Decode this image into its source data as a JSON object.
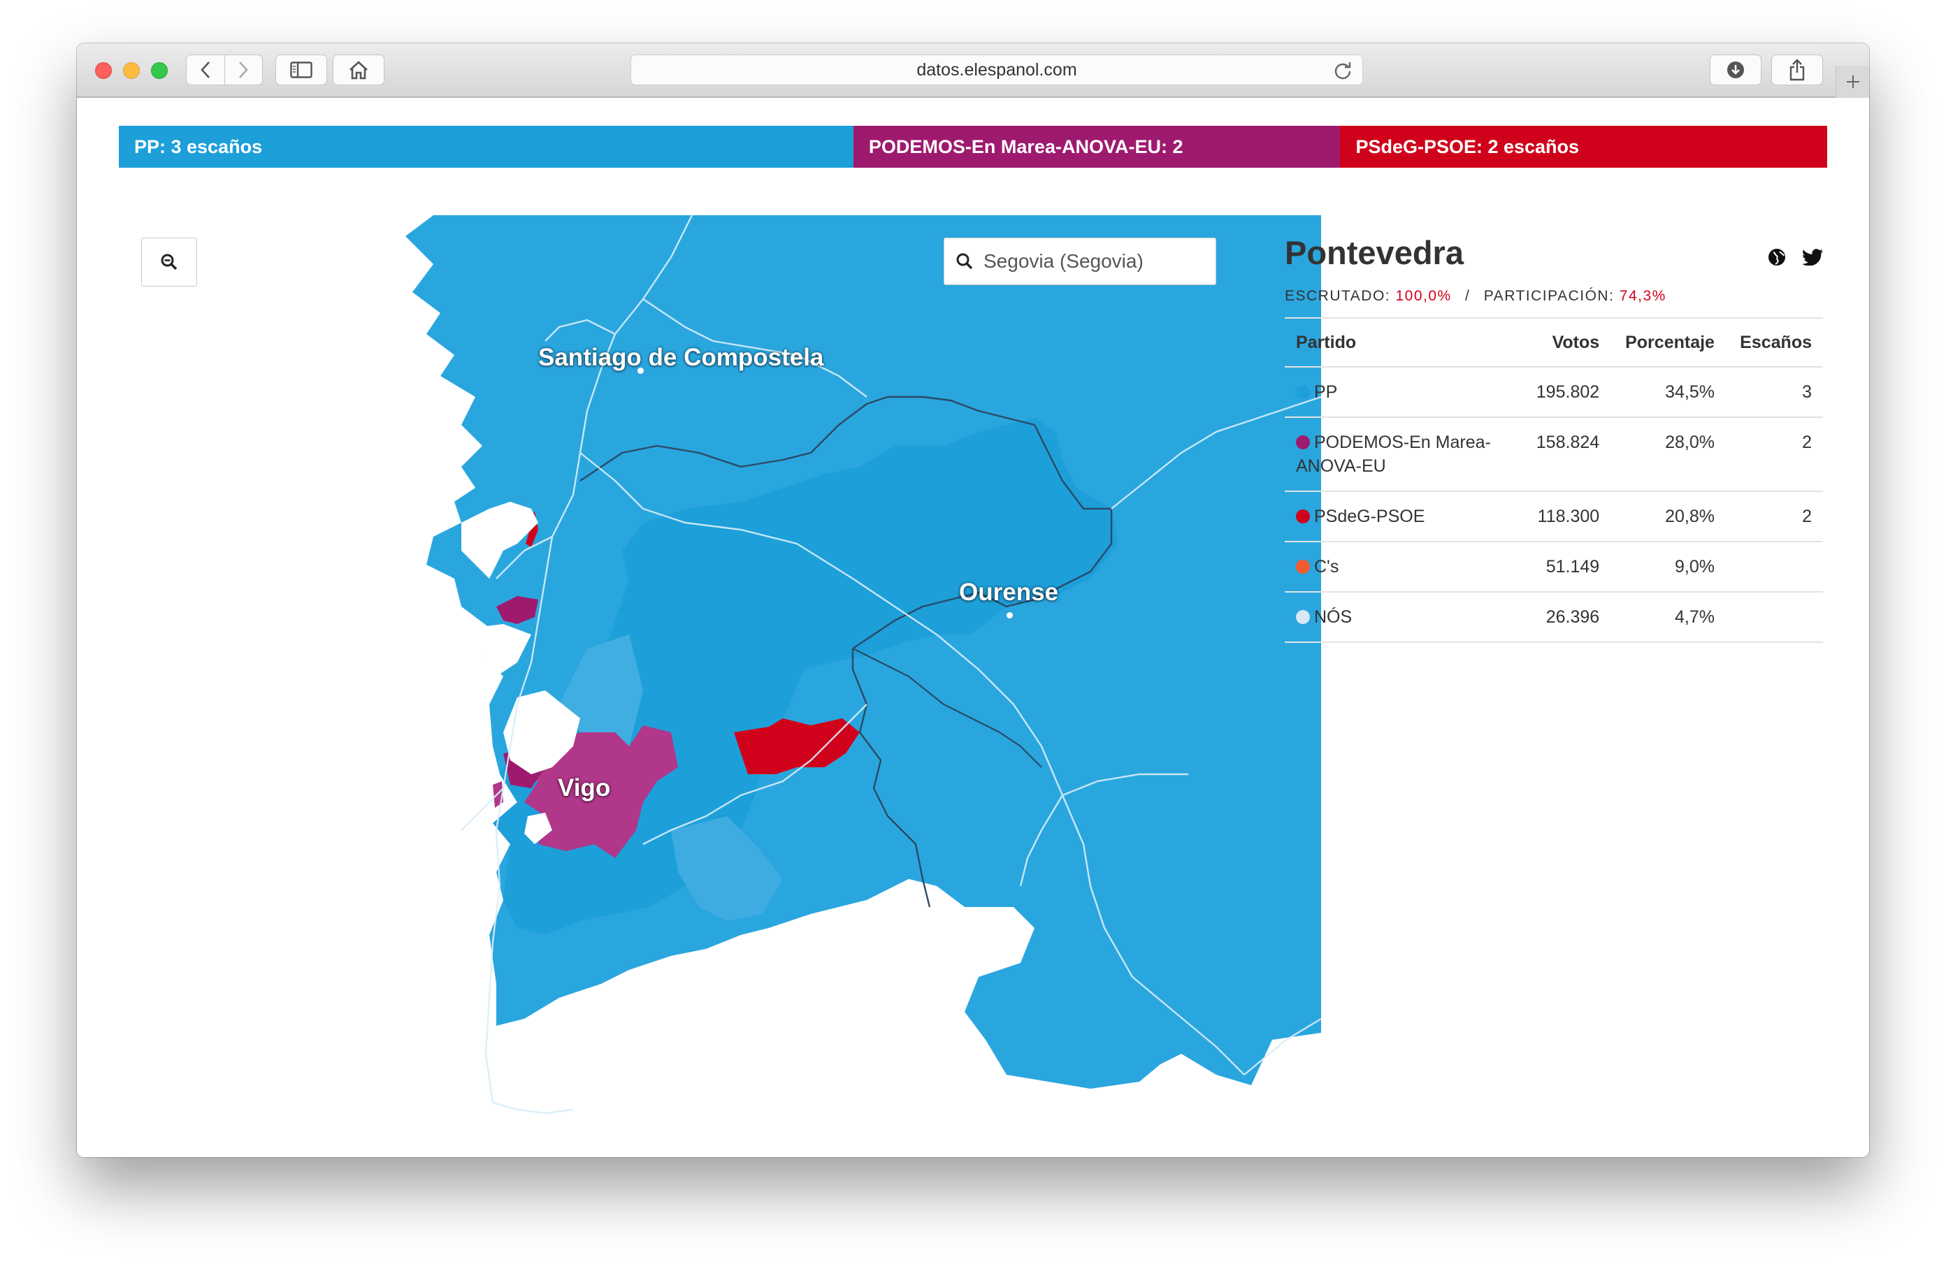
{
  "browser": {
    "url": "datos.elespanol.com"
  },
  "seatbar": [
    {
      "label": "PP: 3 escaños",
      "color": "#1d9fd9",
      "share": 0.43
    },
    {
      "label": "PODEMOS-En Marea-ANOVA-EU: 2",
      "color": "#9e1a6f",
      "share": 0.285
    },
    {
      "label": "PSdeG-PSOE: 2 escaños",
      "color": "#d0021b",
      "share": 0.285
    }
  ],
  "map": {
    "search_placeholder": "Segovia (Segovia)",
    "cities": {
      "santiago": "Santiago de Compostela",
      "ourense": "Ourense",
      "vigo": "Vigo"
    },
    "icons": {
      "zoom": "zoom-out-icon",
      "search": "search-icon"
    }
  },
  "panel": {
    "title": "Pontevedra",
    "icons": [
      "globe-icon",
      "twitter-icon"
    ],
    "escrutado_label": "ESCRUTADO:",
    "escrutado_value": "100,0%",
    "separator": "/",
    "participacion_label": "PARTICIPACIÓN:",
    "participacion_value": "74,3%",
    "table": {
      "headers": {
        "party": "Partido",
        "votes": "Votos",
        "percent": "Porcentaje",
        "seats": "Escaños"
      },
      "rows": [
        {
          "party": "PP",
          "color": "#1d9fd9",
          "votes": "195.802",
          "percent": "34,5%",
          "seats": "3"
        },
        {
          "party": "PODEMOS-En Marea-ANOVA-EU",
          "color": "#9e1a6f",
          "votes": "158.824",
          "percent": "28,0%",
          "seats": "2"
        },
        {
          "party": "PSdeG-PSOE",
          "color": "#d0021b",
          "votes": "118.300",
          "percent": "20,8%",
          "seats": "2"
        },
        {
          "party": "C's",
          "color": "#f25a2f",
          "votes": "51.149",
          "percent": "9,0%",
          "seats": ""
        },
        {
          "party": "NÓS",
          "color": "#d6e8f5",
          "votes": "26.396",
          "percent": "4,7%",
          "seats": ""
        }
      ]
    }
  }
}
